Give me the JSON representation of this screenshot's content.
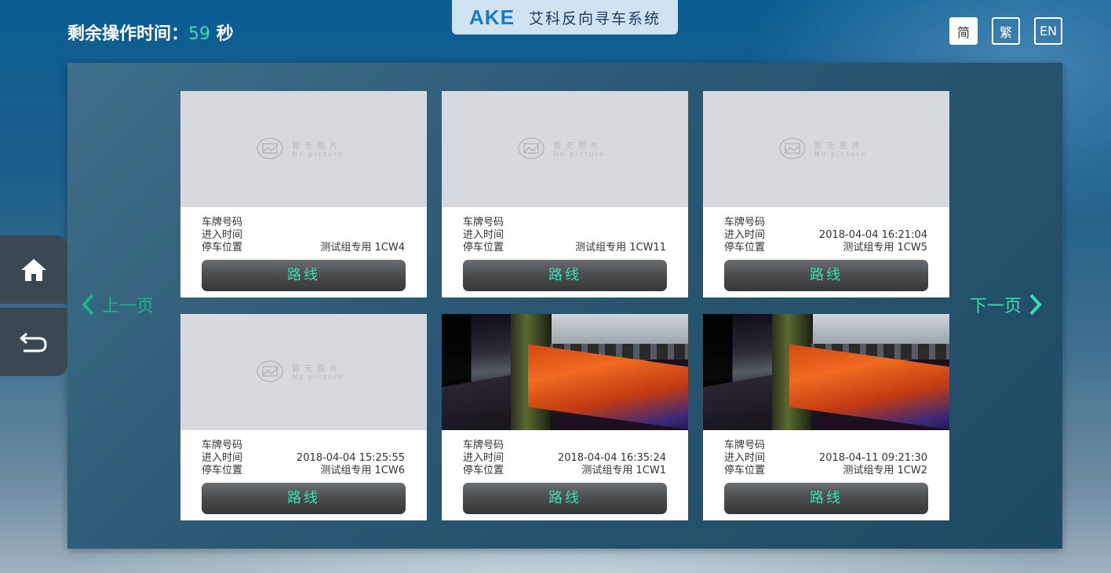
{
  "header": {
    "timer_label": "剩余操作时间：",
    "timer_value": "59",
    "timer_unit": "秒",
    "brand_logo": "AKE",
    "brand_name": "艾科反向寻车系统",
    "languages": [
      {
        "label": "简",
        "active": true
      },
      {
        "label": "繁",
        "active": false
      },
      {
        "label": "EN",
        "active": false
      }
    ]
  },
  "sidebar": {
    "home_icon": "home-icon",
    "back_icon": "return-icon"
  },
  "pagination": {
    "prev_label": "上一页",
    "next_label": "下一页"
  },
  "placeholder": {
    "text_cn": "暂无图片",
    "text_en": "No picture"
  },
  "labels": {
    "plate": "车牌号码",
    "entry_time": "进入时间",
    "location": "停车位置",
    "route_button": "路线"
  },
  "cards": [
    {
      "plate": "",
      "entry_time": "",
      "location": "测试组专用 1CW4",
      "has_photo": false
    },
    {
      "plate": "",
      "entry_time": "",
      "location": "测试组专用 1CW11",
      "has_photo": false
    },
    {
      "plate": "",
      "entry_time": "2018-04-04 16:21:04",
      "location": "测试组专用 1CW5",
      "has_photo": false
    },
    {
      "plate": "",
      "entry_time": "2018-04-04 15:25:55",
      "location": "测试组专用 1CW6",
      "has_photo": false
    },
    {
      "plate": "",
      "entry_time": "2018-04-04 16:35:24",
      "location": "测试组专用 1CW1",
      "has_photo": true
    },
    {
      "plate": "",
      "entry_time": "2018-04-11 09:21:30",
      "location": "测试组专用 1CW2",
      "has_photo": true
    }
  ],
  "colors": {
    "accent": "#35e1b2",
    "brand_blue": "#1a78c9"
  }
}
